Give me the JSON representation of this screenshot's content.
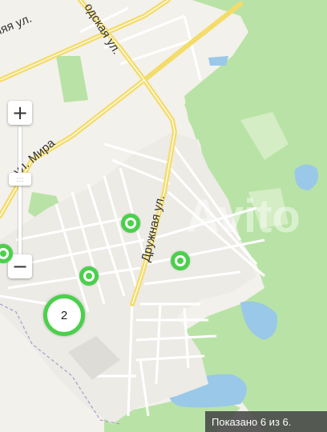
{
  "map": {
    "streets": {
      "top_left": "ляя ул.",
      "top_mid": "одская ул.",
      "mira": "ул. Мира",
      "druzhnaya": "Дружная ул."
    },
    "watermark": "Avito",
    "zoom": {
      "in_label": "+",
      "out_label": "−"
    },
    "cluster": {
      "count": "2"
    },
    "status_text": "Показано 6 из 6.",
    "colors": {
      "marker": "#4bd04b",
      "forest": "#b9e3a6",
      "water": "#9ac8e8",
      "road": "#f4dc6a"
    }
  }
}
